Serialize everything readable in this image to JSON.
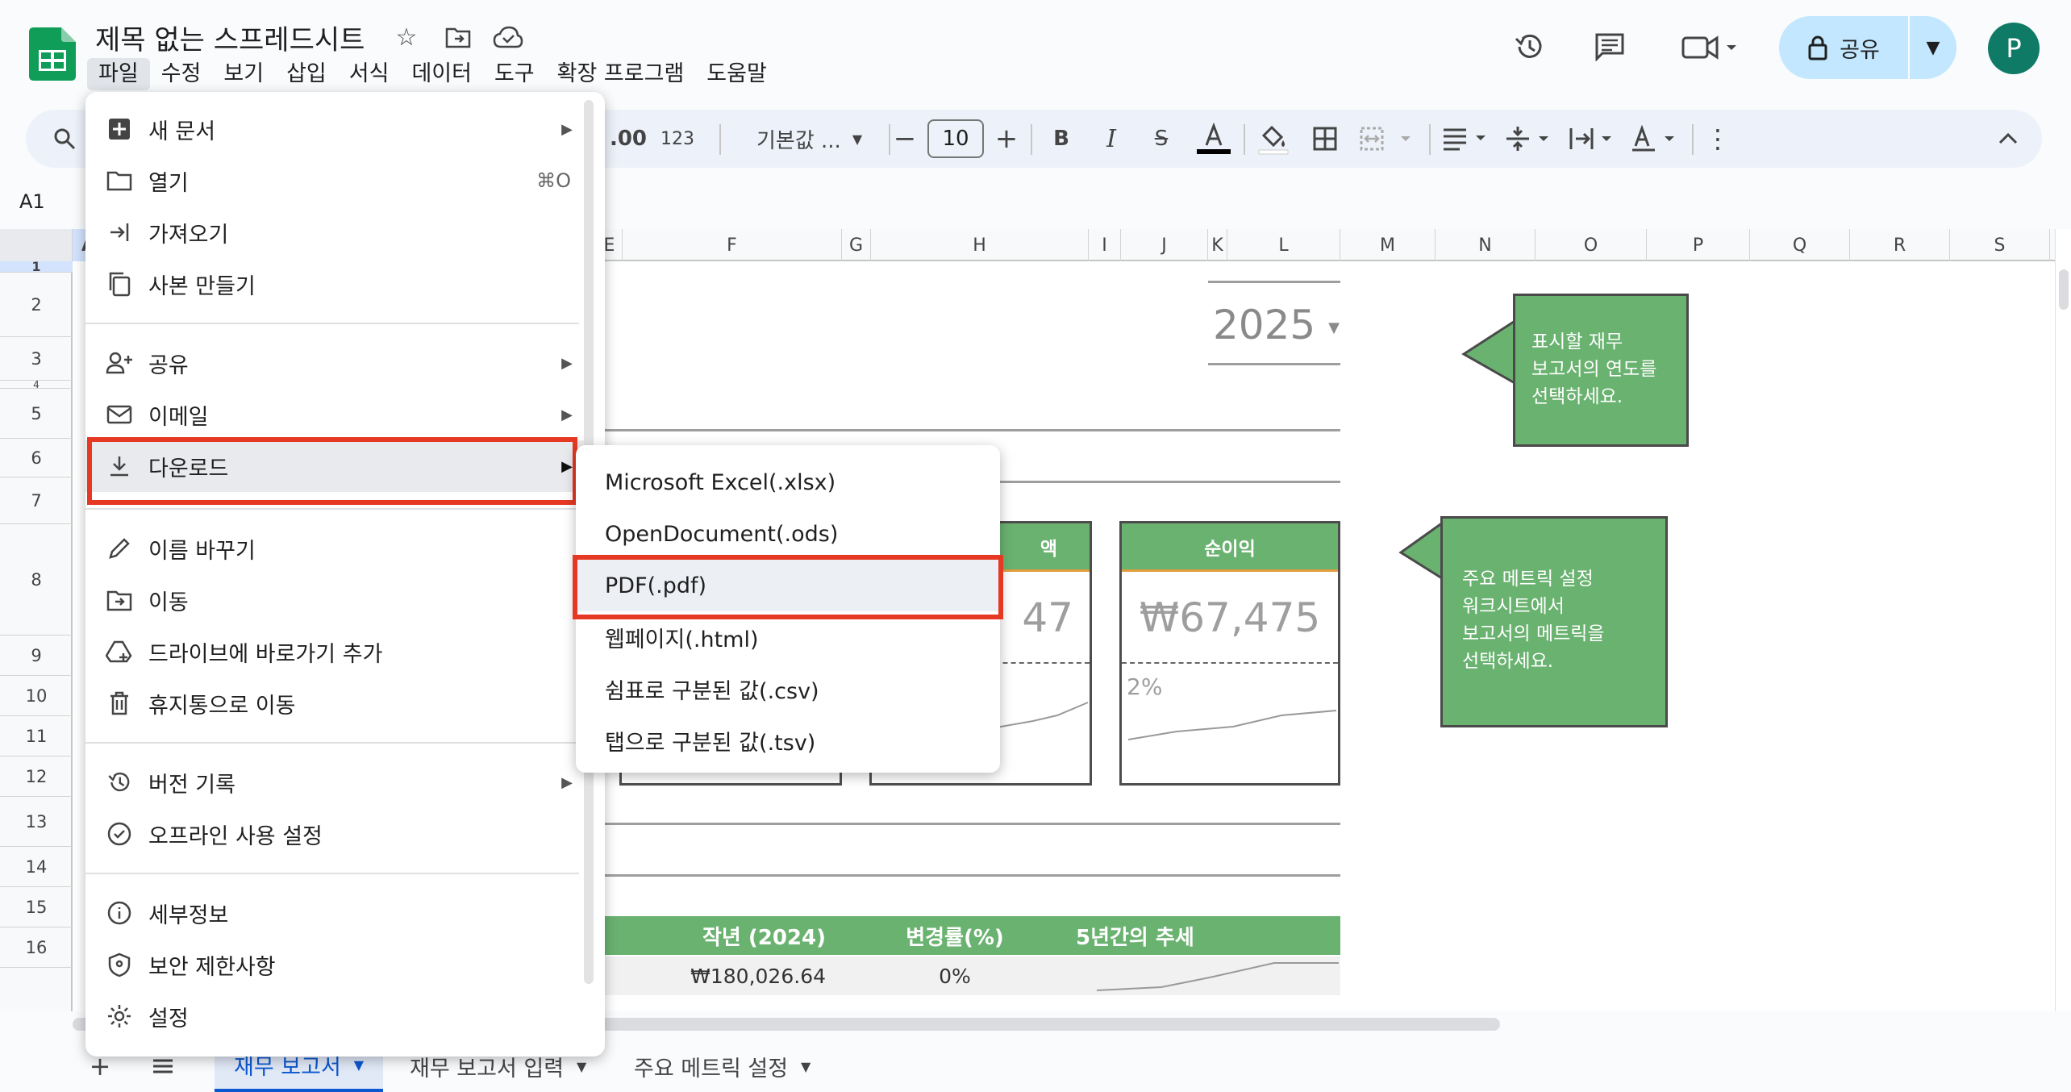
{
  "doc": {
    "title": "제목 없는 스프레드시트"
  },
  "menubar": [
    "파일",
    "수정",
    "보기",
    "삽입",
    "서식",
    "데이터",
    "도구",
    "확장 프로그램",
    "도움말"
  ],
  "header": {
    "share_label": "공유",
    "avatar_letter": "P"
  },
  "toolbar": {
    "decimal_label": ".00",
    "format_123": "123",
    "font_name": "기본값 ...",
    "font_size": "10"
  },
  "namebox": "A1",
  "columns": [
    "A",
    "E",
    "F",
    "G",
    "H",
    "I",
    "J",
    "K",
    "L",
    "M",
    "N",
    "O",
    "P",
    "Q",
    "R",
    "S"
  ],
  "rows": [
    "1",
    "2",
    "3",
    "4",
    "5",
    "6",
    "7",
    "8",
    "9",
    "10",
    "11",
    "12",
    "13",
    "14",
    "15",
    "16"
  ],
  "sheet": {
    "year": "2025",
    "callout1": [
      "표시할 재무",
      "보고서의 연도를",
      "선택하세요."
    ],
    "callout2": [
      "주요 메트릭 설정",
      "워크시트에서",
      "보고서의 메트릭을",
      "선택하세요."
    ],
    "card_partial": {
      "title": "액",
      "value": "47"
    },
    "card_net": {
      "title": "순이익",
      "value": "₩67,475",
      "pct": "2%"
    },
    "table_headers": [
      "작년 (2024)",
      "변경률(%)",
      "5년간의 추세"
    ],
    "table_row1": [
      "₩180,026.64",
      "0%"
    ]
  },
  "file_menu": {
    "items": [
      {
        "label": "새 문서",
        "icon": "new-doc-icon",
        "arrow": true
      },
      {
        "label": "열기",
        "icon": "folder-icon",
        "shortcut": "⌘O"
      },
      {
        "label": "가져오기",
        "icon": "import-icon"
      },
      {
        "label": "사본 만들기",
        "icon": "copy-icon"
      },
      {
        "label": "공유",
        "icon": "share-person-icon",
        "arrow": true
      },
      {
        "label": "이메일",
        "icon": "mail-icon",
        "arrow": true
      },
      {
        "label": "다운로드",
        "icon": "download-icon",
        "arrow": true
      },
      {
        "label": "이름 바꾸기",
        "icon": "pencil-icon"
      },
      {
        "label": "이동",
        "icon": "move-folder-icon"
      },
      {
        "label": "드라이브에 바로가기 추가",
        "icon": "drive-shortcut-icon"
      },
      {
        "label": "휴지통으로 이동",
        "icon": "trash-icon"
      },
      {
        "label": "버전 기록",
        "icon": "history-icon",
        "arrow": true
      },
      {
        "label": "오프라인 사용 설정",
        "icon": "offline-icon"
      },
      {
        "label": "세부정보",
        "icon": "info-icon"
      },
      {
        "label": "보안 제한사항",
        "icon": "shield-icon"
      },
      {
        "label": "설정",
        "icon": "settings-icon"
      }
    ]
  },
  "download_submenu": [
    "Microsoft Excel(.xlsx)",
    "OpenDocument(.ods)",
    "PDF(.pdf)",
    "웹페이지(.html)",
    "쉼표로 구분된 값(.csv)",
    "탭으로 구분된 값(.tsv)"
  ],
  "sheet_tabs": [
    "재무 보고서",
    "재무 보고서 입력",
    "주요 메트릭 설정"
  ],
  "colors": {
    "accent_green": "#6ab270",
    "highlight_red": "#e53924",
    "share_bg": "#c2e7ff",
    "avatar": "#0f7a66"
  }
}
